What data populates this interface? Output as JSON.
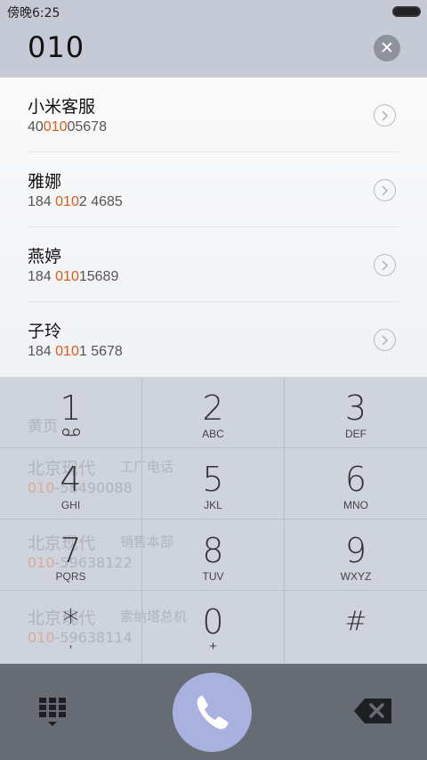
{
  "status_bar": {
    "time": "傍晚6:25"
  },
  "search": {
    "query": "010"
  },
  "results": [
    {
      "name": "小米客服",
      "number_pre": "40",
      "number_hl": "010",
      "number_post": "05678"
    },
    {
      "name": "雅娜",
      "number_pre": "184 ",
      "number_hl": "010",
      "number_post": "2 4685"
    },
    {
      "name": "燕婷",
      "number_pre": "184 ",
      "number_hl": "010",
      "number_post": "15689"
    },
    {
      "name": "子玲",
      "number_pre": "184 ",
      "number_hl": "010",
      "number_post": "1 5678"
    }
  ],
  "background_entries": [
    {
      "name": "黄页"
    },
    {
      "name": "北京现代",
      "tag": "工厂电话",
      "number_pre": "010",
      "number_post": "-58490088"
    },
    {
      "name": "北京现代",
      "tag": "销售本部",
      "number_pre": "010",
      "number_post": "-59638122"
    },
    {
      "name": "北京现代",
      "tag": "索纳塔总机",
      "number_pre": "010",
      "number_post": "-59638114"
    }
  ],
  "keypad": [
    {
      "digit": "1",
      "letters": "",
      "icon": "voicemail-icon"
    },
    {
      "digit": "2",
      "letters": "ABC"
    },
    {
      "digit": "3",
      "letters": "DEF"
    },
    {
      "digit": "4",
      "letters": "GHI"
    },
    {
      "digit": "5",
      "letters": "JKL"
    },
    {
      "digit": "6",
      "letters": "MNO"
    },
    {
      "digit": "7",
      "letters": "PQRS"
    },
    {
      "digit": "8",
      "letters": "TUV"
    },
    {
      "digit": "9",
      "letters": "WXYZ"
    },
    {
      "digit": "*",
      "letters": ","
    },
    {
      "digit": "0",
      "letters": "+"
    },
    {
      "digit": "#",
      "letters": ""
    }
  ],
  "bottom_bar": {
    "dialpad_icon": "dialpad-grid-icon",
    "call_icon": "phone-handset-icon",
    "backspace_icon": "backspace-icon"
  },
  "colors": {
    "highlight": "#e05b17",
    "call_button": "#a9b2de",
    "bottom_bar": "#676b73"
  }
}
